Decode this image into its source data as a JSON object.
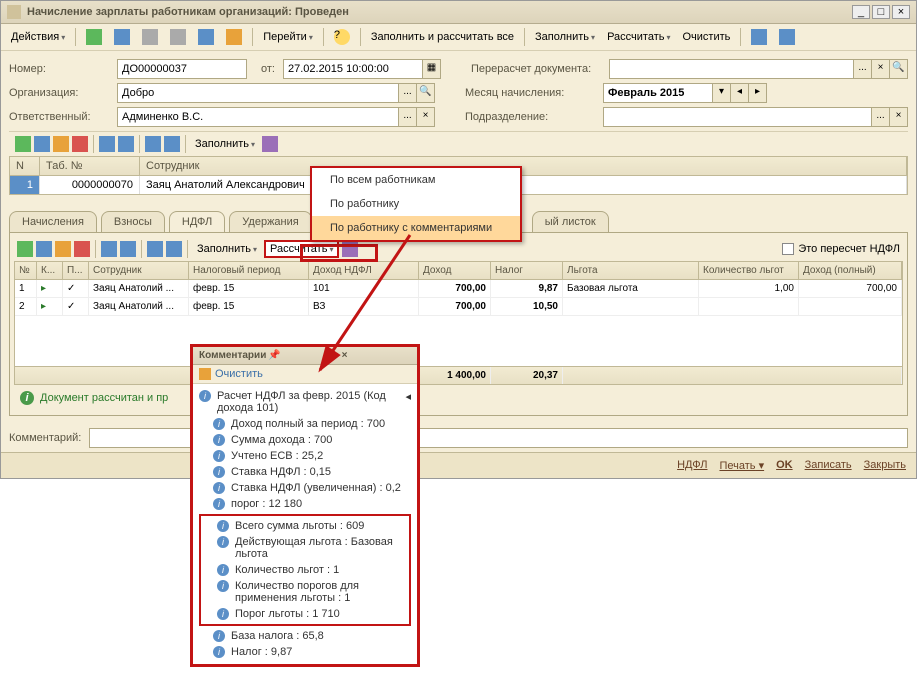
{
  "window": {
    "title": "Начисление зарплаты работникам организаций: Проведен"
  },
  "toolbar": {
    "actions": "Действия",
    "go": "Перейти",
    "fill_calc_all": "Заполнить и рассчитать все",
    "fill": "Заполнить",
    "calc": "Рассчитать",
    "clear": "Очистить"
  },
  "form": {
    "number_lbl": "Номер:",
    "number_val": "ДО00000037",
    "from_lbl": "от:",
    "date_val": "27.02.2015 10:00:00",
    "org_lbl": "Организация:",
    "org_val": "Добро",
    "resp_lbl": "Ответственный:",
    "resp_val": "Админенко В.С.",
    "recalc_lbl": "Перерасчет документа:",
    "month_lbl": "Месяц начисления:",
    "month_val": "Февраль 2015",
    "dept_lbl": "Подразделение:"
  },
  "emp_toolbar": {
    "fill": "Заполнить"
  },
  "emp_table": {
    "headers": {
      "n": "N",
      "tab": "Таб. №",
      "emp": "Сотрудник"
    },
    "row": {
      "n": "1",
      "tab": "0000000070",
      "emp": "Заяц Анатолий Александрович"
    }
  },
  "dropdown": {
    "item1": "По всем работникам",
    "item2": "По работнику",
    "item3": "По работнику с комментариями"
  },
  "tabs": {
    "t1": "Начисления",
    "t2": "Взносы",
    "t3": "НДФЛ",
    "t4": "Удержания",
    "t6": "ый листок"
  },
  "ndfl_toolbar": {
    "fill": "Заполнить",
    "calc": "Рассчитать",
    "cb_label": "Это пересчет НДФЛ"
  },
  "data_table": {
    "headers": {
      "n": "№",
      "k": "К...",
      "p": "П...",
      "emp": "Сотрудник",
      "period": "Налоговый период",
      "income_code": "Доход НДФЛ",
      "income": "Доход",
      "tax": "Налог",
      "benefit": "Льгота",
      "benefit_qty": "Количество льгот",
      "income_full": "Доход (полный)"
    },
    "rows": [
      {
        "n": "1",
        "emp": "Заяц Анатолий ...",
        "period": "февр. 15",
        "income_code": "101",
        "income": "700,00",
        "tax": "9,87",
        "benefit": "Базовая льгота",
        "benefit_qty": "1,00",
        "income_full": "700,00"
      },
      {
        "n": "2",
        "emp": "Заяц Анатолий ...",
        "period": "февр. 15",
        "income_code": "ВЗ",
        "income": "700,00",
        "tax": "10,50",
        "benefit": "",
        "benefit_qty": "",
        "income_full": ""
      }
    ],
    "totals": {
      "income": "1 400,00",
      "tax": "20,37"
    }
  },
  "status": "Документ рассчитан и пр",
  "comment_lbl": "Комментарий:",
  "footer": {
    "ndfl": "НДФЛ",
    "print": "Печать",
    "ok": "OK",
    "save": "Записать",
    "close": "Закрыть"
  },
  "comments_popup": {
    "title": "Комментарии",
    "clear": "Очистить",
    "head": "Расчет НДФЛ за февр. 2015 (Код дохода 101)",
    "lines": [
      "Доход полный за период : 700",
      "Сумма дохода : 700",
      "Учтено ЕСВ : 25,2",
      "Ставка НДФЛ : 0,15",
      "Ставка НДФЛ (увеличенная) : 0,2",
      "порог : 12 180"
    ],
    "boxed": [
      "Всего сумма льготы : 609",
      "Действующая льгота : Базовая льгота",
      "Количество льгот : 1",
      "Количество порогов для применения льготы : 1",
      "Порог льготы : 1 710"
    ],
    "tail": [
      "База налога : 65,8",
      "Налог : 9,87"
    ]
  }
}
